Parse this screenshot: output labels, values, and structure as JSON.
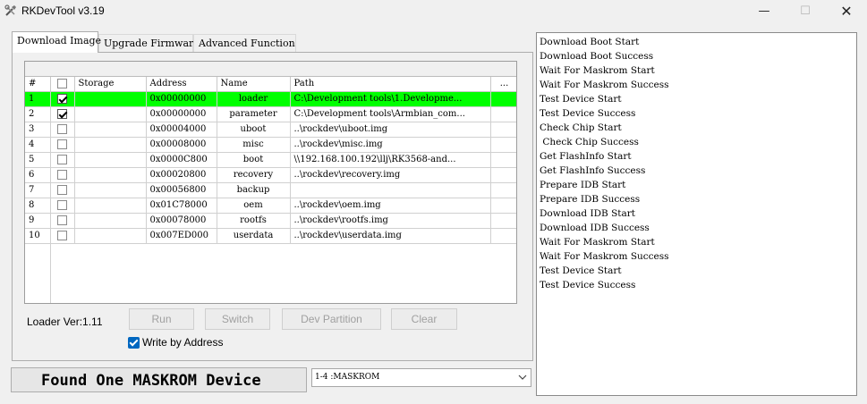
{
  "window": {
    "title": "RKDevTool v3.19",
    "controls": {
      "minimize": "—",
      "maximize": "☐",
      "close": "✕"
    }
  },
  "tabs": [
    {
      "label": "Download Image",
      "active": true
    },
    {
      "label": "Upgrade Firmware",
      "active": false
    },
    {
      "label": "Advanced Function",
      "active": false
    }
  ],
  "table": {
    "headers": [
      "#",
      "",
      "Storage",
      "Address",
      "Name",
      "Path",
      "..."
    ],
    "rows": [
      {
        "num": "1",
        "checked": true,
        "storage": "",
        "address": "0x00000000",
        "name": "loader",
        "path": "C:\\Development tools\\1.Developme...",
        "selected": true
      },
      {
        "num": "2",
        "checked": true,
        "storage": "",
        "address": "0x00000000",
        "name": "parameter",
        "path": "C:\\Development tools\\Armbian_com...",
        "selected": false
      },
      {
        "num": "3",
        "checked": false,
        "storage": "",
        "address": "0x00004000",
        "name": "uboot",
        "path": "..\\rockdev\\uboot.img",
        "selected": false
      },
      {
        "num": "4",
        "checked": false,
        "storage": "",
        "address": "0x00008000",
        "name": "misc",
        "path": "..\\rockdev\\misc.img",
        "selected": false
      },
      {
        "num": "5",
        "checked": false,
        "storage": "",
        "address": "0x0000C800",
        "name": "boot",
        "path": "\\\\192.168.100.192\\llj\\RK3568-and...",
        "selected": false
      },
      {
        "num": "6",
        "checked": false,
        "storage": "",
        "address": "0x00020800",
        "name": "recovery",
        "path": "..\\rockdev\\recovery.img",
        "selected": false
      },
      {
        "num": "7",
        "checked": false,
        "storage": "",
        "address": "0x00056800",
        "name": "backup",
        "path": "",
        "selected": false
      },
      {
        "num": "8",
        "checked": false,
        "storage": "",
        "address": "0x01C78000",
        "name": "oem",
        "path": "..\\rockdev\\oem.img",
        "selected": false
      },
      {
        "num": "9",
        "checked": false,
        "storage": "",
        "address": "0x00078000",
        "name": "rootfs",
        "path": "..\\rockdev\\rootfs.img",
        "selected": false
      },
      {
        "num": "10",
        "checked": false,
        "storage": "",
        "address": "0x007ED000",
        "name": "userdata",
        "path": "..\\rockdev\\userdata.img",
        "selected": false
      }
    ]
  },
  "controls": {
    "loader_version": "Loader Ver:1.11",
    "run": "Run",
    "switch": "Switch",
    "dev_partition": "Dev Partition",
    "clear": "Clear",
    "write_by_address": "Write by Address",
    "write_by_address_checked": true
  },
  "status": {
    "text": "Found One MASKROM Device"
  },
  "device_select": {
    "value": "1-4 :MASKROM"
  },
  "log": [
    "Download Boot Start",
    "Download Boot Success",
    "Wait For Maskrom Start",
    "Wait For Maskrom Success",
    "Test Device Start",
    "Test Device Success",
    "Check Chip Start",
    " Check Chip Success",
    "Get FlashInfo Start",
    "Get FlashInfo Success",
    "Prepare IDB Start",
    "Prepare IDB Success",
    "Download IDB Start",
    "Download IDB Success",
    "Wait For Maskrom Start",
    "Wait For Maskrom Success",
    "Test Device Start",
    "Test Device Success"
  ],
  "colors": {
    "selected_row": "#00ff00",
    "checkbox_accent": "#0067c0",
    "disabled_text": "#a0a0a0"
  }
}
